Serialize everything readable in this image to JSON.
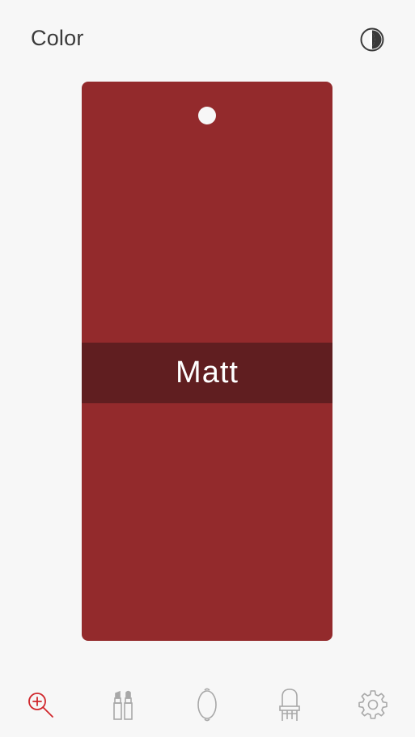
{
  "header": {
    "title": "Color",
    "contrast_icon": "contrast-icon"
  },
  "swatch": {
    "finish_label": "Matt",
    "color": "#932a2c",
    "band_color": "#601e20"
  },
  "tabbar": {
    "active_color": "#d0262b",
    "inactive_color": "#a8a8a8",
    "tabs": [
      {
        "icon": "zoom-in-icon",
        "active": true
      },
      {
        "icon": "lipstick-icon",
        "active": false
      },
      {
        "icon": "mirror-icon",
        "active": false
      },
      {
        "icon": "vanity-chair-icon",
        "active": false
      },
      {
        "icon": "gear-icon",
        "active": false
      }
    ]
  }
}
